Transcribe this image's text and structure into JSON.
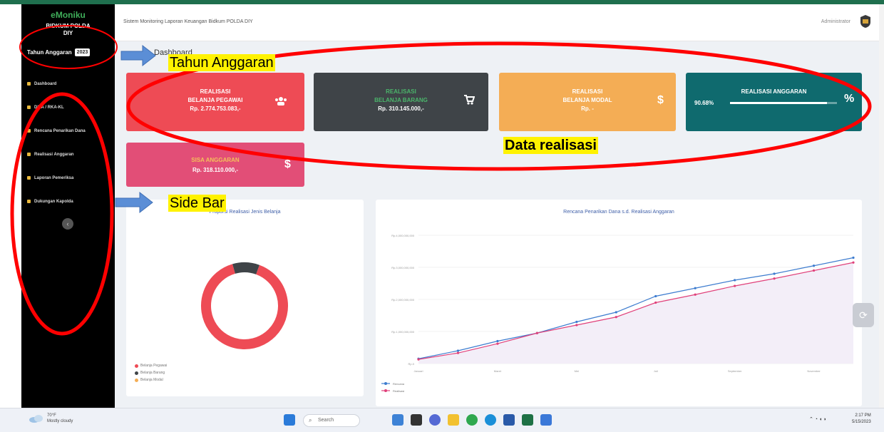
{
  "sidebar": {
    "brand": "eMoniku",
    "org_line1": "BIDKUM POLDA",
    "org_line2": "DIY",
    "year_label": "Tahun Anggaran",
    "year_value": "2023",
    "items": [
      {
        "label": "Dashboard",
        "icon": "dashboard-icon"
      },
      {
        "label": "DIPA / RKA-KL",
        "icon": "document-icon"
      },
      {
        "label": "Rencana Penarikan Dana",
        "icon": "list-icon"
      },
      {
        "label": "Realisasi Anggaran",
        "icon": "chart-line-icon"
      },
      {
        "label": "Laporan Pemeriksa",
        "icon": "report-icon"
      },
      {
        "label": "Dukungan Kapolda",
        "icon": "table-icon"
      }
    ]
  },
  "header": {
    "title": "Sistem Monitoring Laporan Keuangan Bidkum POLDA DIY",
    "user": "Administrator"
  },
  "breadcrumb": "Dashboard",
  "cards": [
    {
      "line1": "REALISASI",
      "line2": "BELANJA PEGAWAI",
      "amount": "Rp. 2.774.753.083,-",
      "icon": "users-icon",
      "color": "#ee4b55"
    },
    {
      "line1": "REALISASI",
      "line2": "BELANJA BARANG",
      "amount": "Rp. 310.145.000,-",
      "icon": "cart-icon",
      "color": "#3f4448"
    },
    {
      "line1": "REALISASI",
      "line2": "BELANJA MODAL",
      "amount": "Rp. -",
      "icon": "dollar-icon",
      "color": "#f4ad55"
    },
    {
      "line1": "REALISASI ANGGARAN",
      "line2": "",
      "amount": "",
      "percent_label": "90.68%",
      "percent": 90.68,
      "icon": "percent-icon",
      "color": "#0f6a6e"
    },
    {
      "line1": "SISA ANGGARAN",
      "line2": "",
      "amount": "Rp. 318.110.000,-",
      "icon": "dollar-icon",
      "color": "#e24e77"
    }
  ],
  "annotations": {
    "tahun": "Tahun Anggaran",
    "data": "Data realisasi",
    "sidebar": "Side Bar"
  },
  "donut": {
    "title": "Proporsi Realisasi Jenis Belanja",
    "legend": [
      {
        "label": "Belanja Pegawai",
        "color": "#ee4b55"
      },
      {
        "label": "Belanja Barang",
        "color": "#3f4448"
      },
      {
        "label": "Belanja Modal",
        "color": "#f4ad55"
      }
    ],
    "values": [
      2774753083,
      310145000,
      0
    ]
  },
  "chart_data": {
    "type": "line",
    "title": "Rencana Penarikan Dana s.d. Realisasi Anggaran",
    "categories": [
      "Januari",
      "",
      "Maret",
      "",
      "Mei",
      "",
      "Juli",
      "",
      "September",
      "",
      "November",
      ""
    ],
    "series": [
      {
        "name": "Rencana",
        "color": "#3d7ccf",
        "values": [
          150000000,
          400000000,
          700000000,
          950000000,
          1300000000,
          1600000000,
          2100000000,
          2350000000,
          2600000000,
          2800000000,
          3050000000,
          3300000000
        ]
      },
      {
        "name": "Realisasi",
        "color": "#e0407a",
        "values": [
          130000000,
          330000000,
          620000000,
          950000000,
          1200000000,
          1450000000,
          1900000000,
          2150000000,
          2420000000,
          2650000000,
          2900000000,
          3150000000
        ]
      }
    ],
    "ylim": [
      0,
      4000000000
    ],
    "yticks": [
      "Rp.0",
      "Rp.1,000,000,000",
      "Rp.2,000,000,000",
      "Rp.3,000,000,000",
      "Rp.4,000,000,000"
    ],
    "grid": true,
    "legend_position": "bottom-left"
  },
  "taskbar": {
    "weather_temp": "70°F",
    "weather_desc": "Mostly cloudy",
    "search": "Search",
    "time": "2:17 PM",
    "date": "5/15/2023"
  }
}
